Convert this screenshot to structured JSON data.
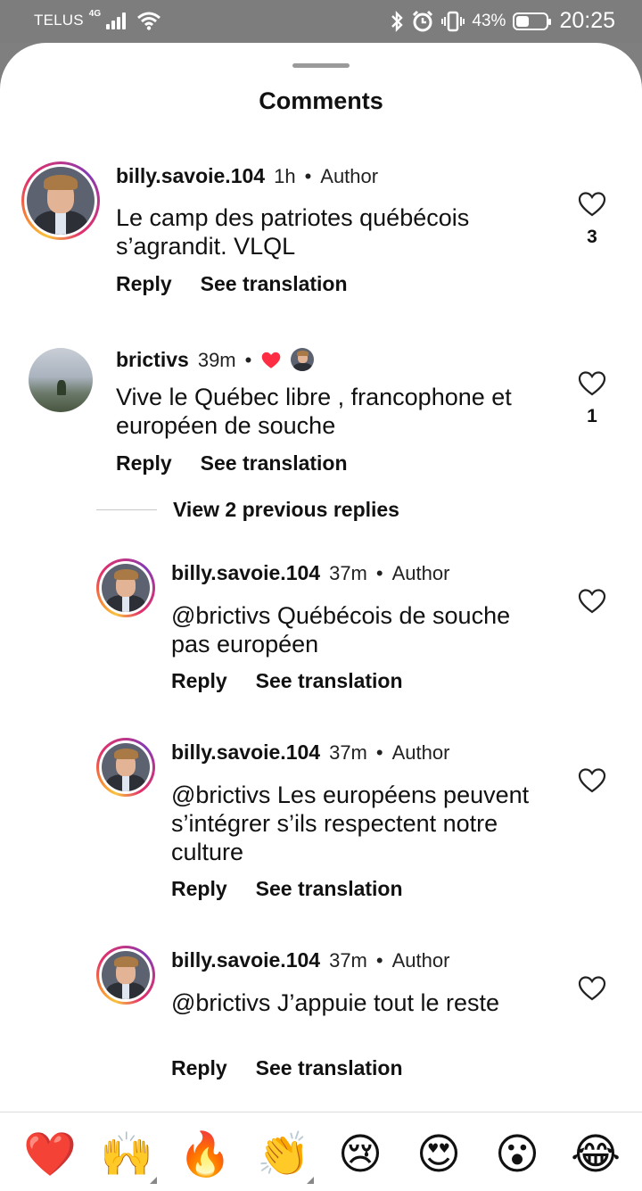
{
  "status_bar": {
    "carrier": "TELUS",
    "network": "4G",
    "battery_percent": "43%",
    "battery_level": 0.43,
    "time": "20:25"
  },
  "sheet": {
    "title": "Comments"
  },
  "comments": [
    {
      "username": "billy.savoie.104",
      "time": "1h",
      "badge": "Author",
      "text": "Le camp des patriotes québécois s’agrandit. VLQL",
      "reply_label": "Reply",
      "translate_label": "See translation",
      "likes": "3"
    },
    {
      "username": "brictivs",
      "time": "39m",
      "text": "Vive le Québec libre , francophone et européen de souche",
      "reply_label": "Reply",
      "translate_label": "See translation",
      "likes": "1"
    }
  ],
  "view_replies": "View 2 previous replies",
  "replies": [
    {
      "username": "billy.savoie.104",
      "time": "37m",
      "badge": "Author",
      "text": "@brictivs Québécois de souche pas européen",
      "reply_label": "Reply",
      "translate_label": "See translation"
    },
    {
      "username": "billy.savoie.104",
      "time": "37m",
      "badge": "Author",
      "text": "@brictivs Les européens peuvent s’intégrer s’ils respectent notre culture",
      "reply_label": "Reply",
      "translate_label": "See translation"
    },
    {
      "username": "billy.savoie.104",
      "time": "37m",
      "badge": "Author",
      "text": "@brictivs J’appuie tout le reste",
      "reply_label": "Reply",
      "translate_label": "See translation"
    }
  ],
  "emoji_bar": [
    "❤️",
    "🙌",
    "🔥",
    "👏",
    "😢",
    "😍",
    "😮",
    "😂"
  ],
  "colors": {
    "like_red": "#ff2d43",
    "status_bar": "#7d7d7d"
  },
  "icons": [
    "bluetooth-icon",
    "alarm-icon",
    "vibrate-icon",
    "wifi-icon",
    "signal-icon",
    "battery-icon",
    "heart-outline-icon",
    "heart-filled-icon"
  ]
}
